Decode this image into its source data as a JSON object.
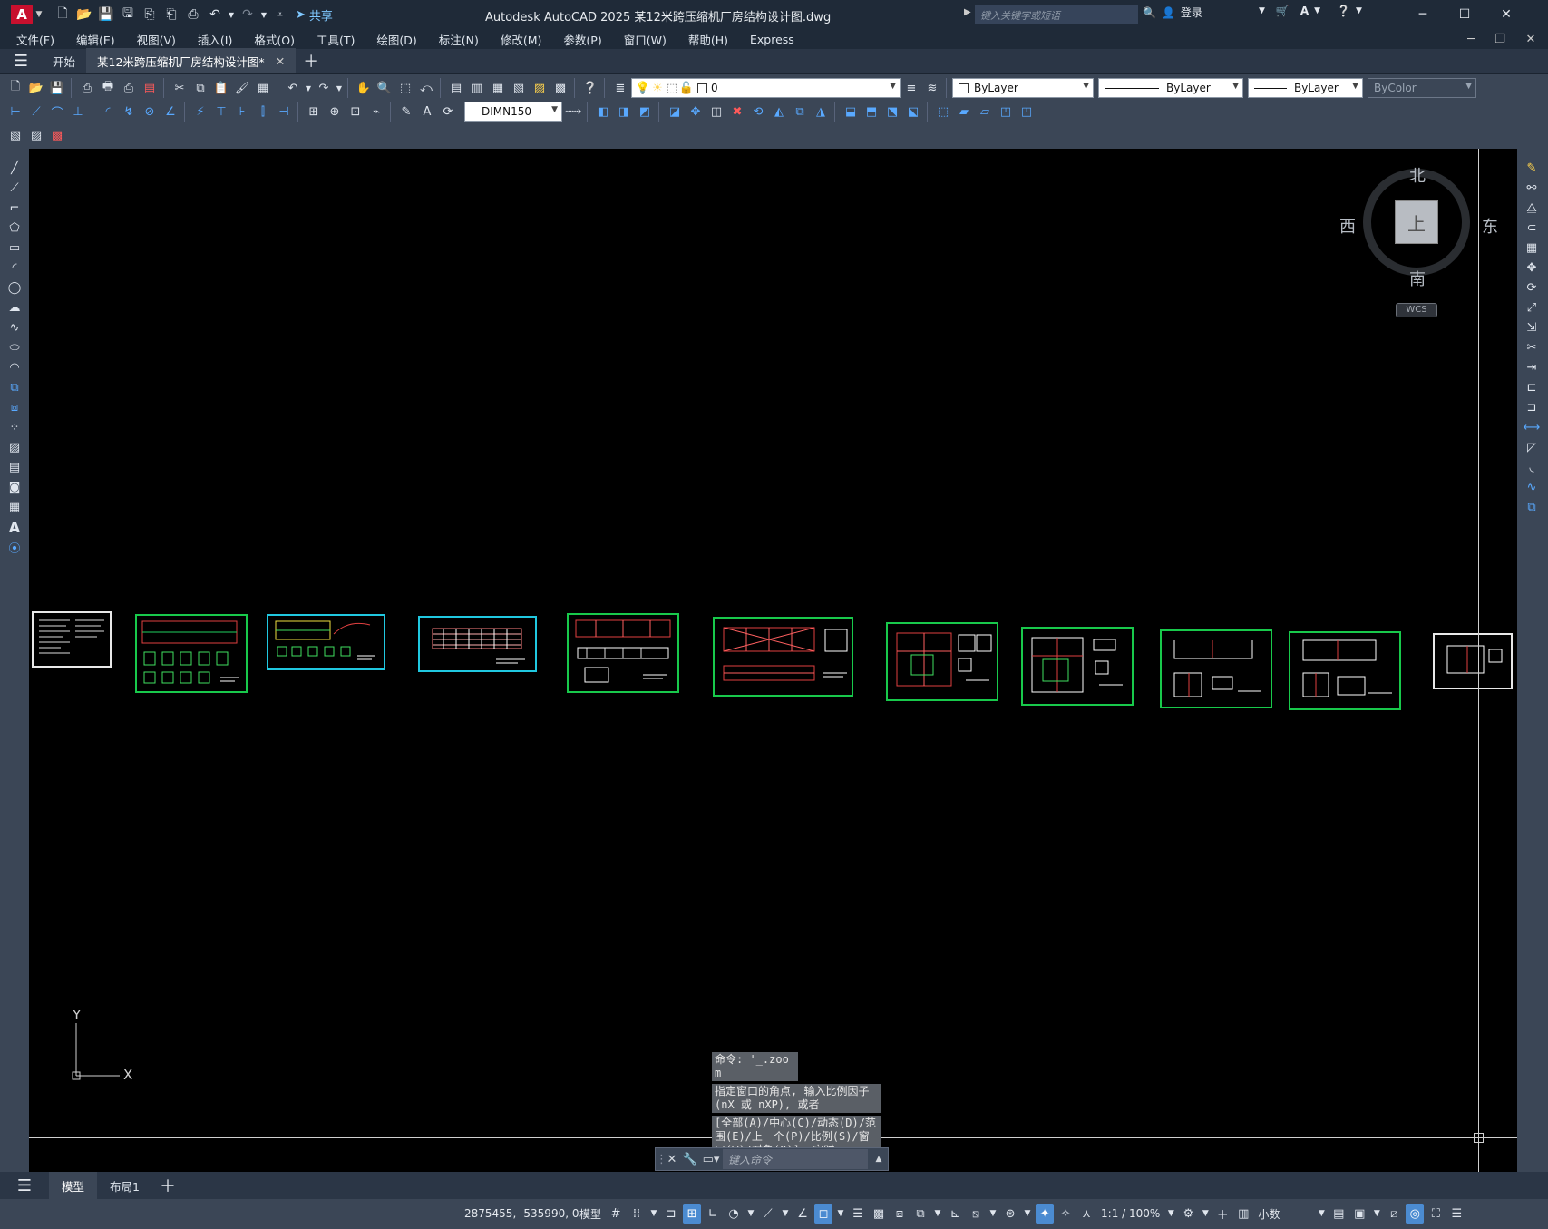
{
  "app": {
    "logo_letter": "A",
    "window_title": "Autodesk AutoCAD 2025    某12米跨压缩机厂房结构设计图.dwg",
    "share_label": "共享",
    "search_placeholder": "键入关键字或短语",
    "login_label": "登录"
  },
  "menu": [
    "文件(F)",
    "编辑(E)",
    "视图(V)",
    "插入(I)",
    "格式(O)",
    "工具(T)",
    "绘图(D)",
    "标注(N)",
    "修改(M)",
    "参数(P)",
    "窗口(W)",
    "帮助(H)",
    "Express"
  ],
  "doc_tabs": {
    "start": "开始",
    "active": "某12米跨压缩机厂房结构设计图*"
  },
  "toolbar": {
    "layer_value": "0",
    "color_value": "ByLayer",
    "linetype_value": "ByLayer",
    "lineweight_value": "ByLayer",
    "plotstyle_value": "ByColor",
    "dimstyle_value": "DIMN150"
  },
  "viewcube": {
    "north": "北",
    "south": "南",
    "east": "东",
    "west": "西",
    "face": "上",
    "wcs": "WCS"
  },
  "ucs": {
    "x": "X",
    "y": "Y"
  },
  "command": {
    "history": [
      "命令: '_.zoom",
      "指定窗口的角点, 输入比例因子 (nX 或 nXP), 或者",
      "[全部(A)/中心(C)/动态(D)/范围(E)/上一个(P)/比例(S)/窗口(W)/对象(O)] <实时>: _e"
    ],
    "placeholder": "键入命令"
  },
  "layout_tabs": {
    "model": "模型",
    "layout1": "布局1"
  },
  "status": {
    "coords": "2875455, -535990, 0",
    "model_label": "模型",
    "scale": "1:1 / 100%",
    "units": "小数"
  },
  "colors": {
    "sheet_green": "#18c94b",
    "sheet_cyan": "#20c8e0",
    "sheet_white": "#e8e8e8",
    "ui_bg": "#3b4656",
    "title_bg": "#1f2a38"
  }
}
